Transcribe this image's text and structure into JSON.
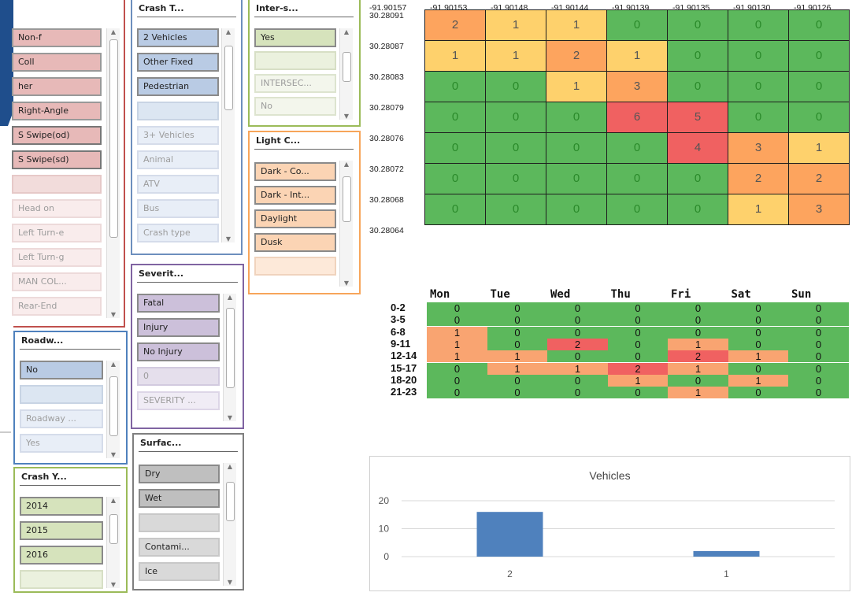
{
  "colors": {
    "green": "#5cb85c",
    "yellow": "#fed16c",
    "orange": "#fda45e",
    "red": "#f06161",
    "light_orange": "#f9a471",
    "bar": "#4f81bd",
    "blue_shape": "#1f4e8c"
  },
  "slicers": {
    "collision": {
      "items": [
        "Non-f",
        "Coll",
        "her",
        "Right-Angle",
        "S Swipe(od)",
        "S Swipe(sd)",
        "",
        "Head on",
        "Left Turn-e",
        "Left Turn-g",
        "MAN COL...",
        "Rear-End"
      ]
    },
    "crash_type": {
      "title": "Crash T...",
      "items": [
        "2 Vehicles",
        "Other Fixed",
        "Pedestrian",
        "",
        "3+ Vehicles",
        "Animal",
        "ATV",
        "Bus",
        "Crash type"
      ]
    },
    "intersection": {
      "title": "Inter-s...",
      "items": [
        "Yes",
        "",
        "INTERSEC...",
        "No"
      ]
    },
    "light": {
      "title": "Light C...",
      "items": [
        "Dark - Co...",
        "Dark - Int...",
        "Daylight",
        "Dusk",
        ""
      ]
    },
    "severity": {
      "title": "Severit...",
      "items": [
        "Fatal",
        "Injury",
        "No Injury",
        "0",
        "SEVERITY ..."
      ]
    },
    "roadway": {
      "title": "Roadw...",
      "items": [
        "No",
        "",
        "Roadway ...",
        "Yes"
      ]
    },
    "surface": {
      "title": "Surfac...",
      "items": [
        "Dry",
        "Wet",
        "",
        "Contami...",
        "Ice"
      ]
    },
    "crash_year": {
      "title": "Crash Y...",
      "items": [
        "2014",
        "2015",
        "2016",
        ""
      ]
    }
  },
  "heatmap_location": {
    "columns": [
      "-91.90157",
      "-91.90153",
      "-91.90148",
      "-91.90144",
      "-91.90139",
      "-91.90135",
      "-91.90130",
      "-91.90126"
    ],
    "rows": [
      "30.28091",
      "30.28087",
      "30.28083",
      "30.28079",
      "30.28076",
      "30.28072",
      "30.28068",
      "30.28064"
    ],
    "values": [
      [
        2,
        1,
        1,
        0,
        0,
        0,
        0
      ],
      [
        1,
        1,
        2,
        1,
        0,
        0,
        0
      ],
      [
        0,
        0,
        1,
        3,
        0,
        0,
        0
      ],
      [
        0,
        0,
        0,
        6,
        5,
        0,
        0
      ],
      [
        0,
        0,
        0,
        0,
        4,
        3,
        1
      ],
      [
        0,
        0,
        0,
        0,
        0,
        2,
        2
      ],
      [
        0,
        0,
        0,
        0,
        0,
        1,
        3
      ]
    ]
  },
  "heatmap_time": {
    "columns": [
      "Mon",
      "Tue",
      "Wed",
      "Thu",
      "Fri",
      "Sat",
      "Sun"
    ],
    "rows": [
      "0-2",
      "3-5",
      "6-8",
      "9-11",
      "12-14",
      "15-17",
      "18-20",
      "21-23"
    ],
    "values": [
      [
        0,
        0,
        0,
        0,
        0,
        0,
        0
      ],
      [
        0,
        0,
        0,
        0,
        0,
        0,
        0
      ],
      [
        1,
        0,
        0,
        0,
        0,
        0,
        0
      ],
      [
        1,
        0,
        2,
        0,
        1,
        0,
        0
      ],
      [
        1,
        1,
        0,
        0,
        2,
        1,
        0
      ],
      [
        0,
        1,
        1,
        2,
        1,
        0,
        0
      ],
      [
        0,
        0,
        0,
        1,
        0,
        1,
        0
      ],
      [
        0,
        0,
        0,
        0,
        1,
        0,
        0
      ]
    ]
  },
  "chart_data": {
    "type": "bar",
    "title": "Vehicles",
    "categories": [
      "2",
      "1"
    ],
    "values": [
      16,
      2
    ],
    "yticks": [
      "20",
      "10",
      "0"
    ],
    "ylim": [
      0,
      20
    ]
  }
}
